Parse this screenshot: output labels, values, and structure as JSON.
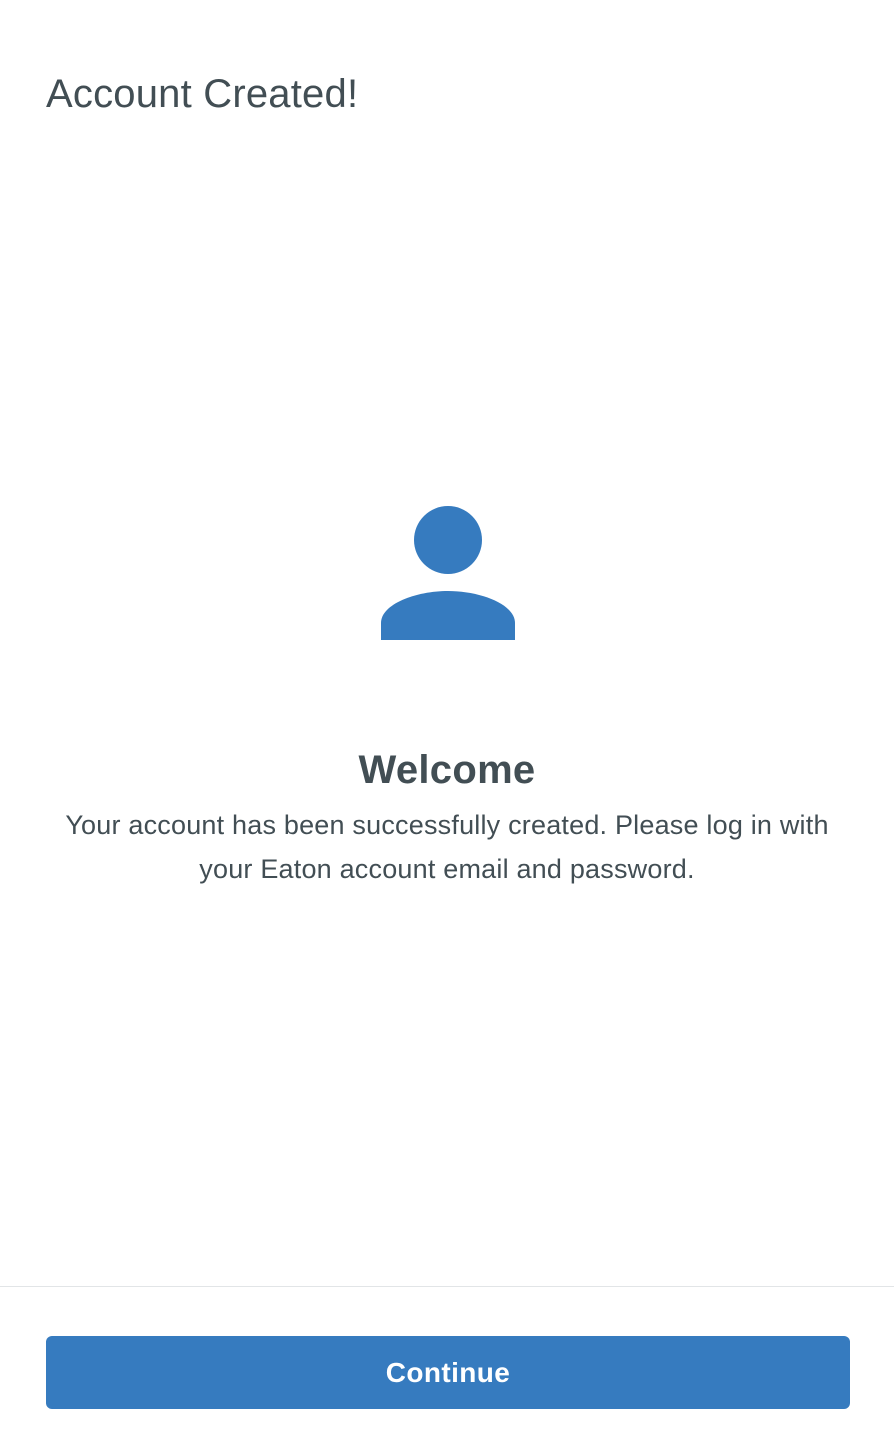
{
  "header": {
    "title": "Account Created!"
  },
  "main": {
    "icon": "person-icon",
    "heading": "Welcome",
    "message": "Your account has been successfully created. Please log in with your Eaton account email and password."
  },
  "footer": {
    "continue_label": "Continue"
  },
  "colors": {
    "accent": "#367bbf",
    "text": "#424e54",
    "divider": "#e2e5e7",
    "background": "#ffffff"
  }
}
